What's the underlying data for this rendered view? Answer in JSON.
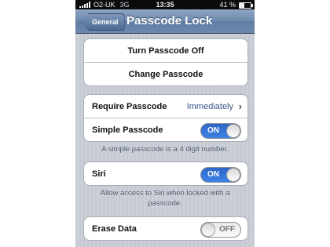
{
  "status_bar": {
    "carrier": "O2-UK",
    "network": "3G",
    "time": "13:35",
    "battery": "41 %",
    "battery_level": 0.41
  },
  "navbar": {
    "back_label": "General",
    "title": "Passcode Lock"
  },
  "passcode_actions": {
    "turn_off": "Turn Passcode Off",
    "change": "Change Passcode"
  },
  "require_passcode": {
    "label": "Require Passcode",
    "value": "Immediately"
  },
  "simple_passcode": {
    "label": "Simple Passcode",
    "toggle": "ON",
    "footnote": "A simple passcode is a 4 digit number."
  },
  "siri": {
    "label": "Siri",
    "toggle": "ON",
    "footnote": "Allow access to Siri when locked with a passcode."
  },
  "erase_data": {
    "label": "Erase Data",
    "toggle": "OFF"
  },
  "icons": {
    "chevron": "›"
  },
  "colors": {
    "navbar": "#6e89ad",
    "toggle_on": "#2b67c8",
    "value_text": "#3a5686"
  }
}
